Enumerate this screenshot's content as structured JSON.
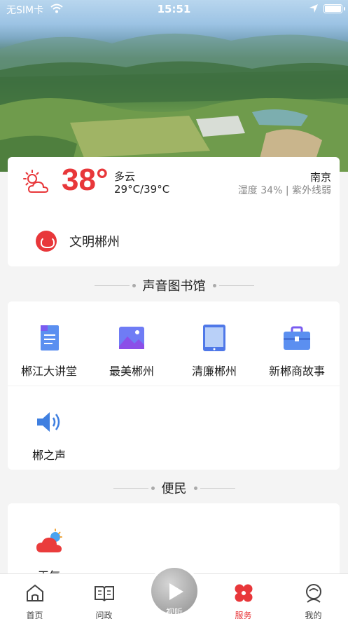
{
  "status": {
    "carrier": "无SIM卡",
    "time": "15:51"
  },
  "weather": {
    "temp": "38°",
    "condition": "多云",
    "range": "29°C/39°C",
    "city": "南京",
    "detail": "湿度 34% | 紫外线弱"
  },
  "civilization": {
    "label": "文明郴州"
  },
  "library": {
    "title": "声音图书馆",
    "items": [
      {
        "label": "郴江大讲堂",
        "icon": "document-icon"
      },
      {
        "label": "最美郴州",
        "icon": "image-icon"
      },
      {
        "label": "清廉郴州",
        "icon": "tablet-icon"
      },
      {
        "label": "新郴商故事",
        "icon": "briefcase-icon"
      },
      {
        "label": "郴之声",
        "icon": "speaker-icon"
      }
    ]
  },
  "convenience": {
    "title": "便民",
    "items": [
      {
        "label": "天气",
        "icon": "weather-icon"
      }
    ]
  },
  "tabs": [
    {
      "label": "首页",
      "icon": "home-icon"
    },
    {
      "label": "问政",
      "icon": "book-icon"
    },
    {
      "label": "视听",
      "icon": "play-icon"
    },
    {
      "label": "服务",
      "icon": "services-icon"
    },
    {
      "label": "我的",
      "icon": "profile-icon"
    }
  ],
  "colors": {
    "accent": "#e8373a",
    "blue": "#5b8ff0",
    "purple": "#7a5cf0"
  }
}
